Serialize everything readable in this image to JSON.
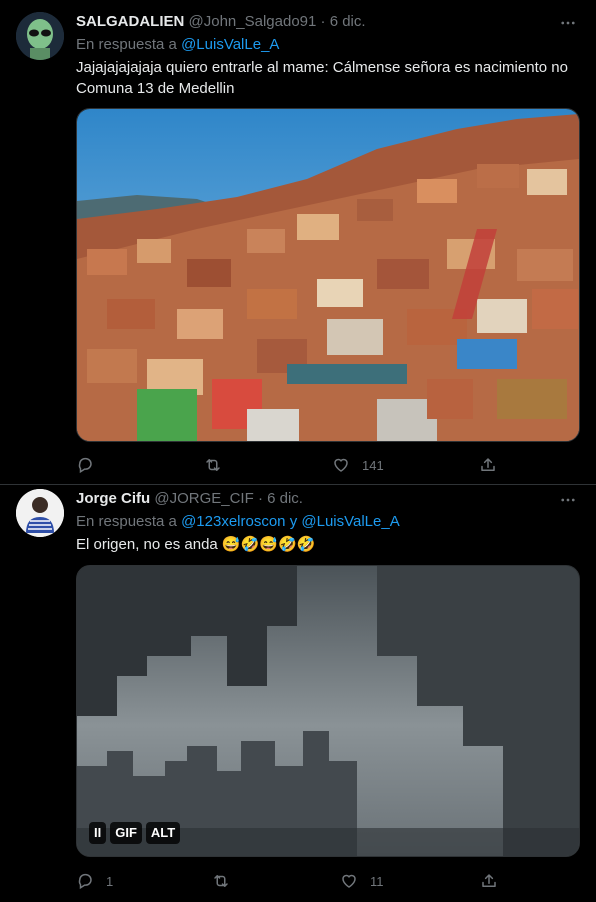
{
  "tweets": [
    {
      "name": "SALGADALIEN",
      "handle": "@John_Salgado91",
      "sep": "·",
      "date": "6 dic.",
      "reply_prefix": "En respuesta a",
      "reply_to": "@LuisValLe_A",
      "text": "Jajajajajajaja quiero entrarle al mame: Cálmense señora es nacimiento no Comuna 13 de Medellin",
      "media": "photo",
      "reply_count": "",
      "retweet_count": "",
      "like_count": "141"
    },
    {
      "name": "Jorge Cifu",
      "handle": "@JORGE_CIF",
      "sep": "·",
      "date": "6 dic.",
      "reply_prefix": "En respuesta a",
      "reply_to": "@123xelroscon",
      "reply_joiner": "y",
      "reply_to_2": "@LuisValLe_A",
      "text": "El origen, no es anda 😅🤣😅🤣🤣",
      "media": "gif",
      "gif_pause": "II",
      "gif_label": "GIF",
      "gif_alt": "ALT",
      "reply_count": "1",
      "retweet_count": "",
      "like_count": "11"
    }
  ],
  "icons": [
    "more-icon",
    "reply-icon",
    "retweet-icon",
    "like-icon",
    "share-icon"
  ],
  "colors": {
    "background": "#000000",
    "text": "#e7e9ea",
    "muted": "#71767b",
    "link": "#1d9bf0"
  }
}
